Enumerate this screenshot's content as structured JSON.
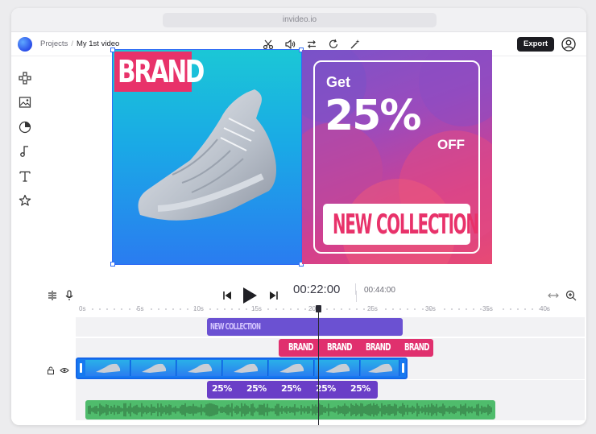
{
  "browser": {
    "url": "invideo.io"
  },
  "header": {
    "breadcrumb": {
      "parent": "Projects",
      "separator": "/",
      "current": "My 1st video"
    },
    "tools": [
      "scissors-icon",
      "volume-icon",
      "swap-icon",
      "rotate-icon",
      "magic-wand-icon"
    ],
    "export_label": "Export"
  },
  "sidebar": {
    "items": [
      "shapes-icon",
      "media-icon",
      "stickers-icon",
      "music-icon",
      "text-icon",
      "star-icon"
    ]
  },
  "canvas": {
    "slide1": {
      "brand_text": "BRAND"
    },
    "slide2": {
      "get_text": "Get",
      "percent_text": "25%",
      "off_text": "OFF",
      "collection_text": "NEW COLLECTION"
    }
  },
  "timeline": {
    "current_time": "00:22:00",
    "total_time": "00:44:00",
    "ruler_labels": [
      "0s",
      "5s",
      "10s",
      "15s",
      "20s",
      "25s",
      "30s",
      "35s",
      "40s"
    ],
    "track_text_clip": "NEW COLLECTION",
    "track_brand_clips": [
      "BRAND",
      "BRAND",
      "BRAND",
      "BRAND"
    ],
    "track_percent_clips": [
      "25%",
      "25%",
      "25%",
      "25%",
      "25%"
    ]
  },
  "colors": {
    "accent": "#2f6cf5",
    "pink": "#e8326a",
    "purple": "#6b51d2",
    "green": "#4fbc6c"
  }
}
